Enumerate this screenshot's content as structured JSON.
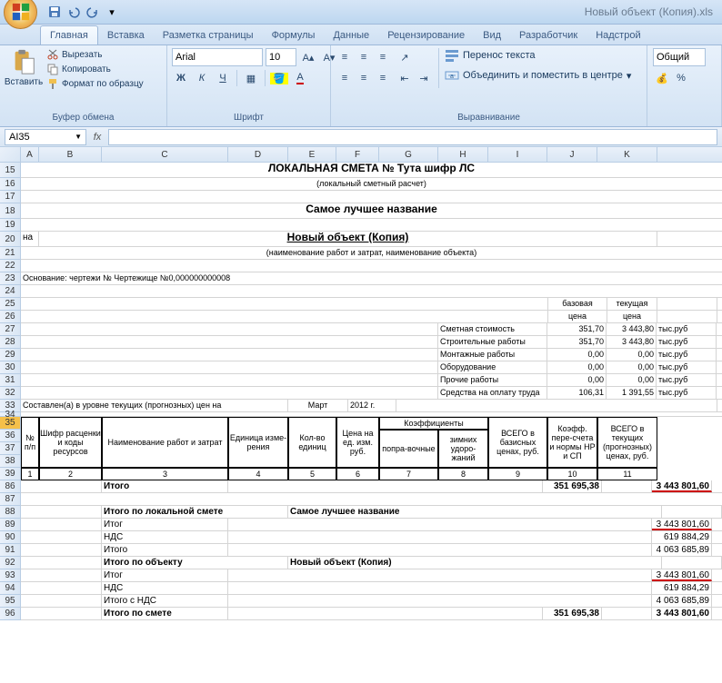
{
  "window": {
    "title": "Новый объект (Копия).xls"
  },
  "tabs": [
    "Главная",
    "Вставка",
    "Разметка страницы",
    "Формулы",
    "Данные",
    "Рецензирование",
    "Вид",
    "Разработчик",
    "Надстрой"
  ],
  "ribbon": {
    "paste": "Вставить",
    "cut": "Вырезать",
    "copy": "Копировать",
    "format_painter": "Формат по образцу",
    "clipboard_label": "Буфер обмена",
    "font_name": "Arial",
    "font_size": "10",
    "font_label": "Шрифт",
    "wrap_text": "Перенос текста",
    "merge_center": "Объединить и поместить в центре",
    "alignment_label": "Выравнивание",
    "number_format": "Общий"
  },
  "namebox": "AI35",
  "cols": [
    "A",
    "B",
    "C",
    "D",
    "E",
    "F",
    "G",
    "H",
    "I",
    "J",
    "K"
  ],
  "row_nums": [
    "15",
    "16",
    "17",
    "18",
    "19",
    "20",
    "21",
    "22",
    "23",
    "24",
    "25",
    "26",
    "27",
    "28",
    "29",
    "30",
    "31",
    "32",
    "33",
    "34",
    "35",
    "36",
    "37",
    "38",
    "39",
    "86",
    "87",
    "88",
    "89",
    "90",
    "91",
    "92",
    "93",
    "94",
    "95",
    "96"
  ],
  "content": {
    "title1": "ЛОКАЛЬНАЯ СМЕТА №  Тута шифр ЛС",
    "subtitle1": "(локальный сметный расчет)",
    "title2": "Самое лучшее название",
    "na": "на",
    "title3": "Новый объект (Копия)",
    "subtitle3": "(наименование работ и затрат, наименование объекта)",
    "basis": "Основание: чертежи № Чертежище №0,000000000008",
    "base_price": "базовая цена",
    "current_price": "текущая цена",
    "rows_stats": [
      {
        "label": "Сметная стоимость",
        "b": "351,70",
        "c": "3 443,80",
        "u": "тыс.руб"
      },
      {
        "label": "Строительные работы",
        "b": "351,70",
        "c": "3 443,80",
        "u": "тыс.руб"
      },
      {
        "label": "Монтажные работы",
        "b": "0,00",
        "c": "0,00",
        "u": "тыс.руб"
      },
      {
        "label": "Оборудование",
        "b": "0,00",
        "c": "0,00",
        "u": "тыс.руб"
      },
      {
        "label": "Прочие работы",
        "b": "0,00",
        "c": "0,00",
        "u": "тыс.руб"
      },
      {
        "label": "Средства на оплату труда",
        "b": "106,31",
        "c": "1 391,55",
        "u": "тыс.руб"
      }
    ],
    "compiled": "Составлен(а) в уровне текущих (прогнозных) цен на",
    "month": "Март",
    "year": "2012 г.",
    "hdr": {
      "c1": "№ п/п",
      "c2": "Шифр расценки и коды ресурсов",
      "c3": "Наименование работ и затрат",
      "c4": "Единица изме-рения",
      "c5": "Кол-во единиц",
      "c6": "Цена на ед. изм. руб.",
      "c7g": "Коэффициенты",
      "c7": "попра-вочные",
      "c8": "зимних удоро-жаний",
      "c9": "ВСЕГО в базисных ценах, руб.",
      "c10": "Коэфф. пере-счета и нормы НР и СП",
      "c11": "ВСЕГО в текущих (прогнозных) ценах, руб."
    },
    "nums": [
      "1",
      "2",
      "3",
      "4",
      "5",
      "6",
      "7",
      "8",
      "9",
      "10",
      "11"
    ],
    "itogo": "Итого",
    "v_base": "351 695,38",
    "v_cur": "3 443 801,60",
    "by_local": "Итого по локальной смете",
    "local_name": "Самое лучшее название",
    "itog": "Итог",
    "nds": "НДС",
    "nds_v": "619 884,29",
    "with_nds": "4 063 685,89",
    "by_object": "Итого по объекту",
    "object_name": "Новый объект (Копия)",
    "with_nds_label": "Итого с НДС",
    "by_estimate": "Итого по смете"
  }
}
